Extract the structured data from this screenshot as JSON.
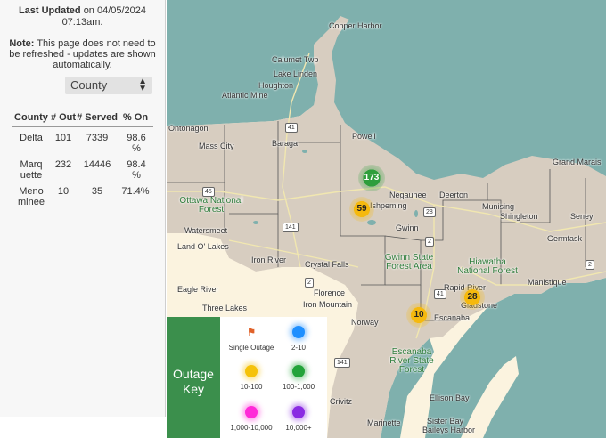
{
  "sidebar": {
    "updated_label": "Last Updated",
    "updated_text": "on 04/05/2024 07:13am.",
    "note_label": "Note:",
    "note_text": "This page does not need to be refreshed - updates are shown automatically.",
    "select_value": "County",
    "table": {
      "headers": [
        "County",
        "# Out",
        "# Served",
        "% On"
      ],
      "rows": [
        {
          "county": "Delta",
          "out": "101",
          "served": "7339",
          "on": "98.6 %"
        },
        {
          "county": "Marquette",
          "out": "232",
          "served": "14446",
          "on": "98.4 %"
        },
        {
          "county": "Menominee",
          "out": "10",
          "served": "35",
          "on": "71.4%"
        }
      ]
    }
  },
  "map": {
    "places": [
      "Copper Harbor",
      "Calumet Twp",
      "Lake Linden",
      "Houghton",
      "Atlantic Mine",
      "Ontonagon",
      "Mass City",
      "Baraga",
      "Powell",
      "Ishpeming",
      "Negaunee",
      "Deerton",
      "Munising",
      "Shingleton",
      "Grand Marais",
      "Seney",
      "Germfask",
      "Watersmeet",
      "Land O' Lakes",
      "Iron River",
      "Crystal Falls",
      "Gwinn",
      "Rapid River",
      "Gladstone",
      "Escanaba",
      "Manistique",
      "Eagle River",
      "Three Lakes",
      "Florence",
      "Iron Mountain",
      "Norway",
      "Crivitz",
      "Marinette",
      "Ellison Bay",
      "Sister Bay",
      "Baileys Harbor"
    ],
    "forests": [
      "Ottawa National Forest",
      "Gwinn State Forest Area",
      "Hiawatha National Forest",
      "Escanaba River State Forest"
    ],
    "routes": [
      "41",
      "45",
      "141",
      "2",
      "28",
      "41",
      "2",
      "141",
      "2"
    ],
    "clusters": [
      {
        "count": "173",
        "level": "100-1,000",
        "color": "#2e9e3c"
      },
      {
        "count": "59",
        "level": "10-100",
        "color": "#f5b90e"
      },
      {
        "count": "28",
        "level": "10-100",
        "color": "#f5b90e"
      },
      {
        "count": "10",
        "level": "10-100",
        "color": "#f5b90e"
      }
    ]
  },
  "key": {
    "title": "Outage Key",
    "items": [
      {
        "label": "Single Outage",
        "icon": "flag-icon",
        "color": "#e0622a"
      },
      {
        "label": "2-10",
        "color": "#1e8fff"
      },
      {
        "label": "10-100",
        "color": "#f5c20a"
      },
      {
        "label": "100-1,000",
        "color": "#23a33a"
      },
      {
        "label": "1,000-10,000",
        "color": "#ff2ad8"
      },
      {
        "label": "10,000+",
        "color": "#8a2be2"
      }
    ]
  }
}
